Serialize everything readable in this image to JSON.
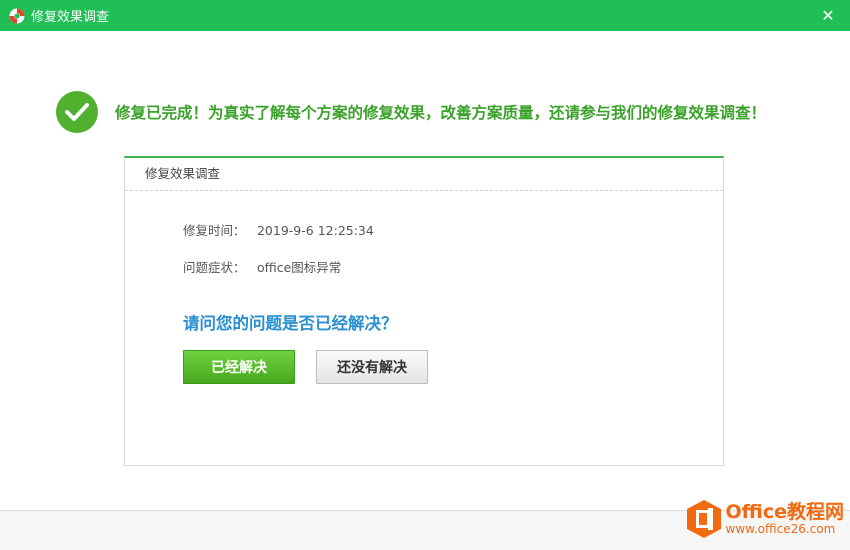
{
  "window": {
    "title": "修复效果调查",
    "close_glyph": "✕",
    "title_icon": "lifebuoy-icon"
  },
  "banner": {
    "icon": "check-circle-icon",
    "message": "修复已完成！为真实了解每个方案的修复效果，改善方案质量，还请参与我们的修复效果调查！"
  },
  "card": {
    "header": "修复效果调查",
    "repair_time_label": "修复时间：",
    "repair_time_value": "2019-9-6 12:25:34",
    "symptom_label": "问题症状：",
    "symptom_value": "office图标异常",
    "question": "请问您的问题是否已经解决？",
    "yes_button": "已经解决",
    "no_button": "还没有解决"
  },
  "watermark": {
    "title": "Office教程网",
    "url": "www.office26.com",
    "icon": "office-logo-icon"
  },
  "colors": {
    "titlebar": "#1fbf55",
    "accent_green": "#3aa12a",
    "question_blue": "#2b8fd0",
    "watermark_orange": "#f06a10"
  }
}
